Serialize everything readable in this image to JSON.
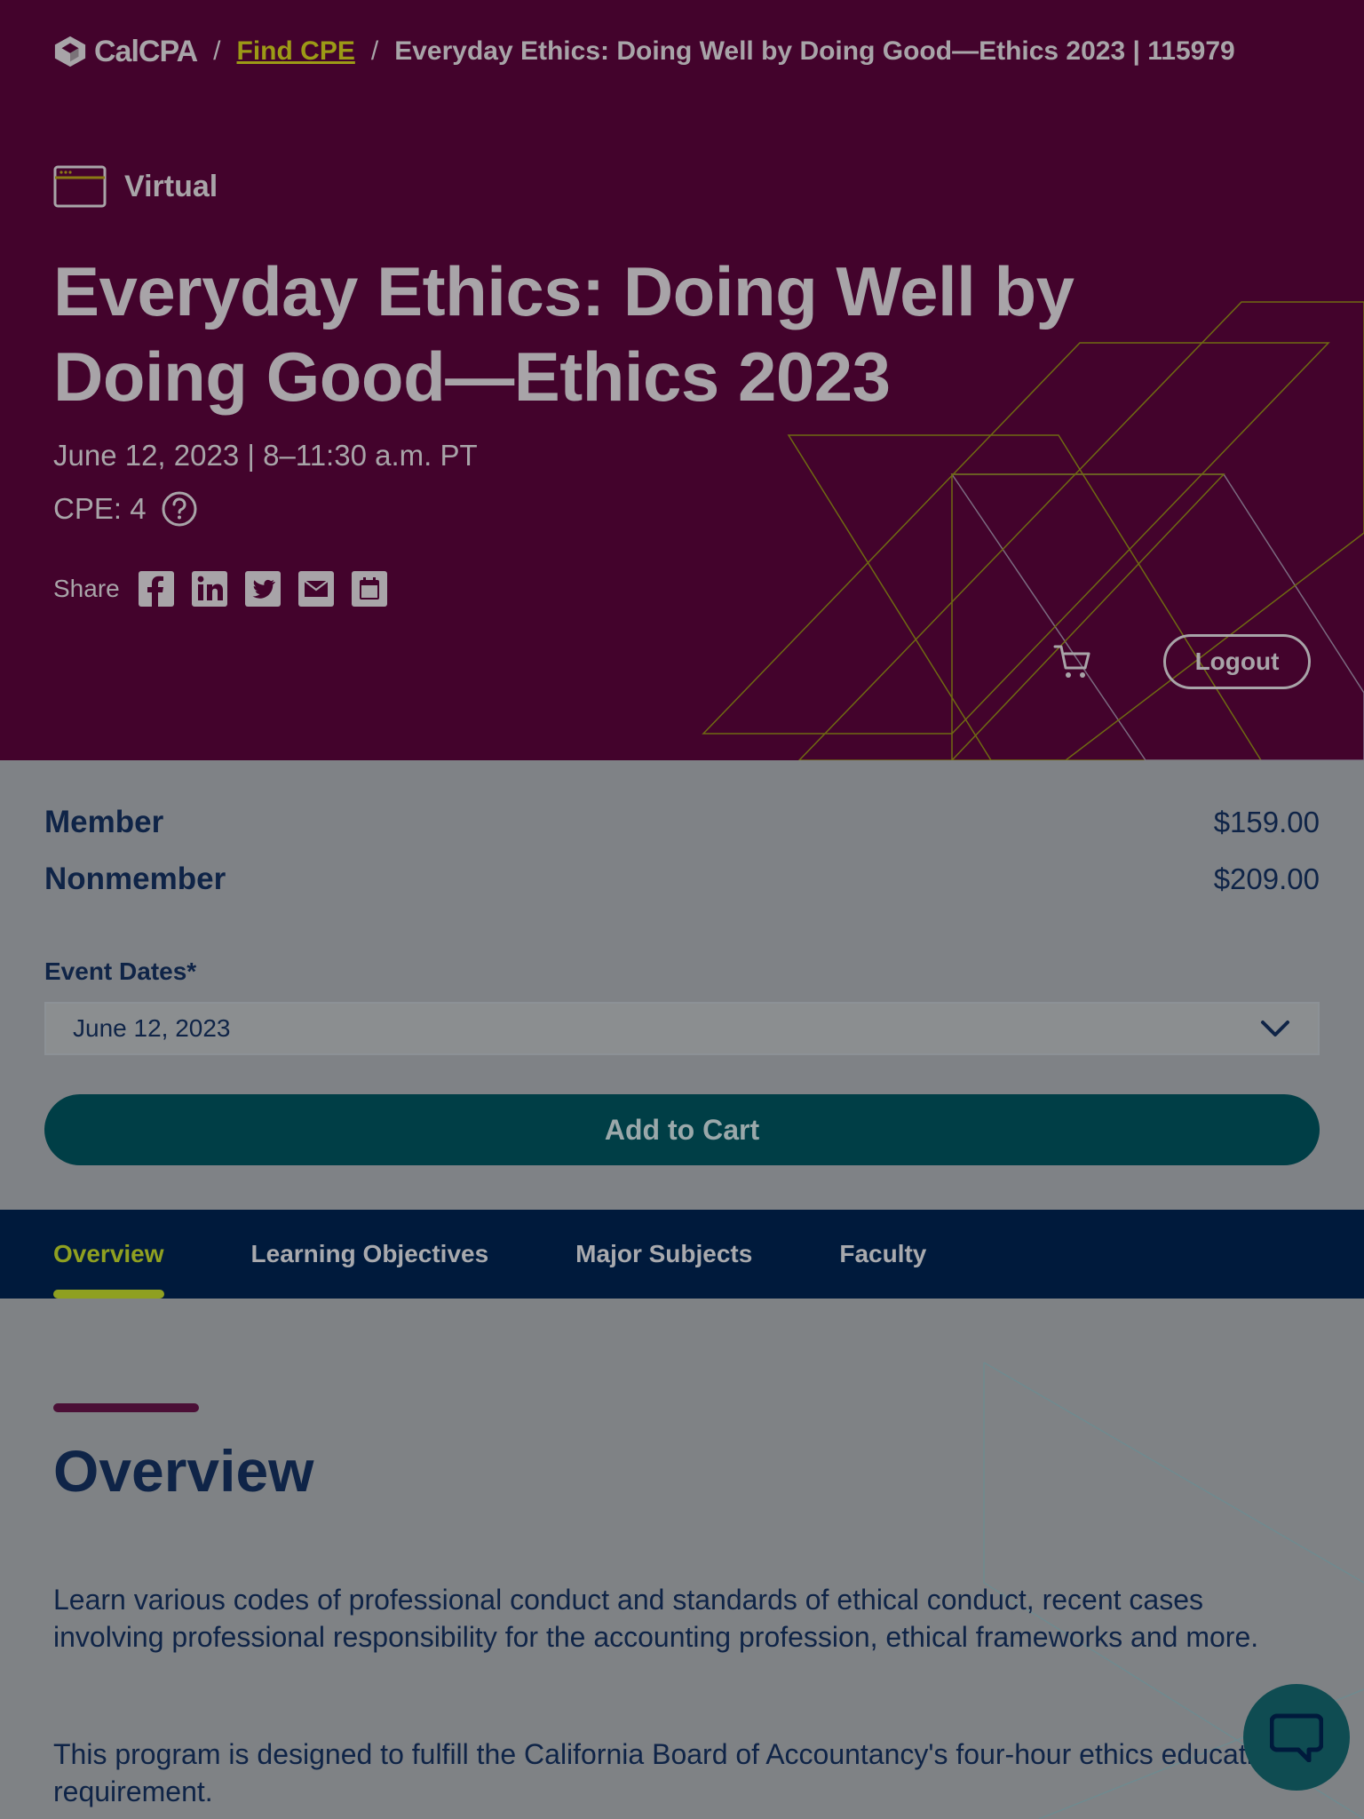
{
  "breadcrumb": {
    "logo": "CalCPA",
    "link": "Find CPE",
    "current": "Everyday Ethics: Doing Well by Doing Good—Ethics 2023 | 115979"
  },
  "event": {
    "format": "Virtual",
    "format_icon": "browser-window-icon",
    "title": "Everyday Ethics: Doing Well by Doing Good—Ethics 2023",
    "date_line": "June 12, 2023 | 8–11:30 a.m. PT",
    "cpe": "CPE: 4"
  },
  "share": {
    "label": "Share",
    "icons": [
      "facebook-icon",
      "linkedin-icon",
      "twitter-icon",
      "email-icon",
      "calendar-icon"
    ]
  },
  "header_actions": {
    "logout": "Logout"
  },
  "pricing": {
    "rows": [
      {
        "label": "Member",
        "value": "$159.00"
      },
      {
        "label": "Nonmember",
        "value": "$209.00"
      }
    ],
    "dates_label": "Event Dates*",
    "selected_date": "June 12, 2023",
    "add_to_cart": "Add to Cart"
  },
  "tabs": [
    {
      "label": "Overview",
      "active": true
    },
    {
      "label": "Learning Objectives",
      "active": false
    },
    {
      "label": "Major Subjects",
      "active": false
    },
    {
      "label": "Faculty",
      "active": false
    }
  ],
  "overview": {
    "heading": "Overview",
    "paragraphs": [
      "Learn various codes of professional conduct and standards of ethical conduct, recent cases involving professional responsibility for the accounting profession, ethical frameworks and more.",
      "This program is designed to fulfill the California Board of Accountancy's four-hour ethics education requirement."
    ]
  },
  "colors": {
    "hero_bg": "#43032c",
    "accent_green": "#8fa021",
    "navy": "#0f2447",
    "teal": "#003e46"
  }
}
